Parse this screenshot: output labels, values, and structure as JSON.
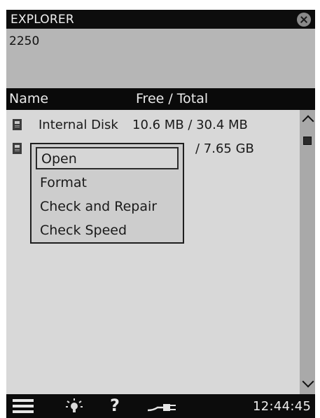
{
  "titlebar": {
    "title": "EXPLORER",
    "close_icon": "close-icon"
  },
  "device": {
    "name": "2250"
  },
  "columns": {
    "name": "Name",
    "free_total": "Free / Total"
  },
  "rows": [
    {
      "name": "Internal Disk",
      "size": "10.6 MB / 30.4 MB",
      "icon": "disk-icon"
    },
    {
      "name": "",
      "size": "/ 7.65 GB",
      "icon": "disk-icon"
    }
  ],
  "context_menu": {
    "items": [
      {
        "label": "Open",
        "selected": true
      },
      {
        "label": "Format",
        "selected": false
      },
      {
        "label": "Check and Repair",
        "selected": false
      },
      {
        "label": "Check Speed",
        "selected": false
      }
    ]
  },
  "scrollbar": {
    "up_icon": "chevron-up-icon",
    "down_icon": "chevron-down-icon"
  },
  "taskbar": {
    "menu_icon": "hamburger-menu-icon",
    "light_icon": "lightbulb-icon",
    "help_label": "?",
    "power_icon": "power-plug-icon",
    "clock": "12:44:45"
  },
  "colors": {
    "bar_background": "#0c0c0c",
    "panel_background": "#b6b6b6",
    "list_background": "#d8d8d8",
    "menu_background": "#cdcdcd"
  }
}
